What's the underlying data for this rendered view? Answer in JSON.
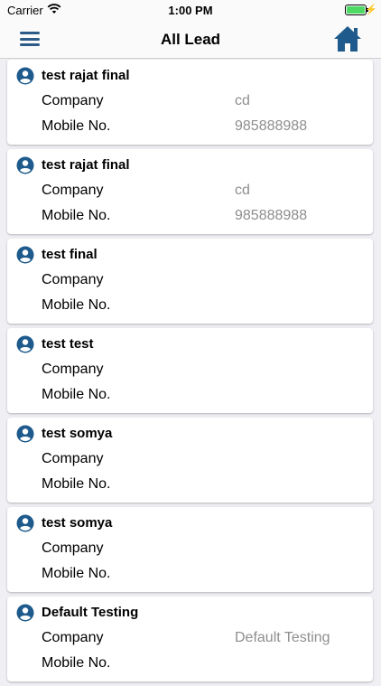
{
  "status_bar": {
    "carrier": "Carrier",
    "time": "1:00 PM"
  },
  "nav": {
    "title": "All Lead"
  },
  "leads": [
    {
      "name": "test rajat final",
      "company_label": "Company",
      "company": "cd",
      "mobile_label": "Mobile No.",
      "mobile": "985888988"
    },
    {
      "name": "test rajat final",
      "company_label": "Company",
      "company": "cd",
      "mobile_label": "Mobile No.",
      "mobile": "985888988"
    },
    {
      "name": "test final",
      "company_label": "Company",
      "company": "",
      "mobile_label": "Mobile No.",
      "mobile": ""
    },
    {
      "name": "test test",
      "company_label": "Company",
      "company": "",
      "mobile_label": "Mobile No.",
      "mobile": ""
    },
    {
      "name": "test somya",
      "company_label": "Company",
      "company": "",
      "mobile_label": "Mobile No.",
      "mobile": ""
    },
    {
      "name": "test somya",
      "company_label": "Company",
      "company": "",
      "mobile_label": "Mobile No.",
      "mobile": ""
    },
    {
      "name": "Default Testing",
      "company_label": "Company",
      "company": "Default Testing",
      "mobile_label": "Mobile No.",
      "mobile": ""
    }
  ],
  "colors": {
    "accent": "#1e5b8c",
    "value_text": "#8e8e8e",
    "battery": "#4cd964"
  },
  "icons": {
    "menu": "hamburger-menu-icon",
    "home": "home-icon",
    "person": "person-circle-icon",
    "wifi": "wifi-icon",
    "battery": "battery-icon"
  }
}
